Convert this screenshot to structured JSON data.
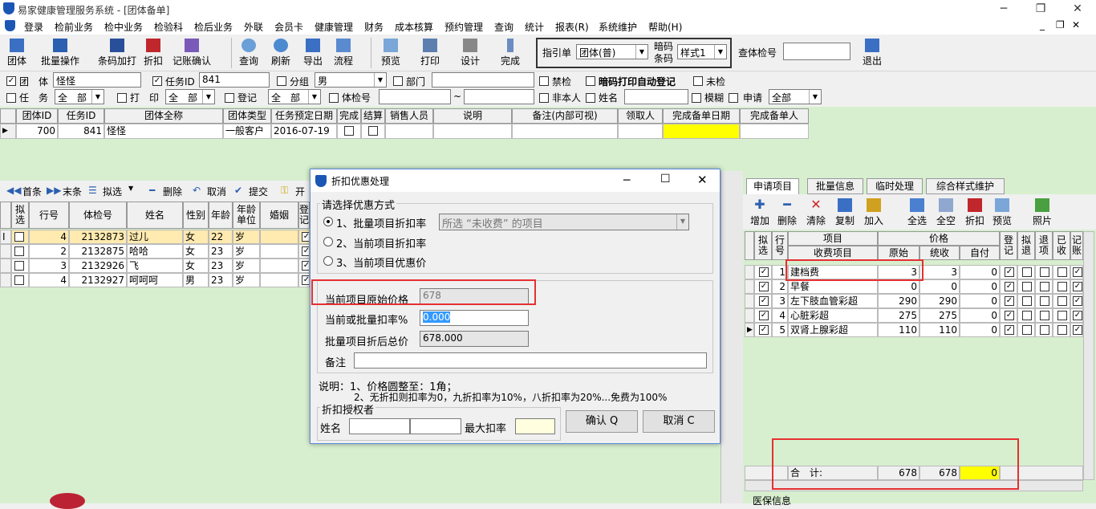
{
  "window": {
    "title": "易家健康管理服务系统 - [团体备单]",
    "min": "─",
    "restore": "❐",
    "close": "✕"
  },
  "menu": [
    "登录",
    "检前业务",
    "检中业务",
    "检验科",
    "检后业务",
    "外联",
    "会员卡",
    "健康管理",
    "财务",
    "成本核算",
    "预约管理",
    "查询",
    "统计",
    "报表(R)",
    "系统维护",
    "帮助(H)"
  ],
  "mdi_controls": {
    "min": "_",
    "restore": "❐",
    "close": "✕"
  },
  "toolbar": {
    "group": "团体",
    "batch": "批量操作",
    "barcode_add": "条码加打",
    "discount": "折扣",
    "bill_confirm": "记账确认",
    "query": "查询",
    "refresh": "刷新",
    "export": "导出",
    "flow": "流程",
    "preview": "预览",
    "print": "打印",
    "design": "设计",
    "complete": "完成",
    "guide_label": "指引单",
    "guide_value": "团体(普)",
    "barcode_label1": "暗码",
    "barcode_label2": "条码",
    "style_value": "样式1",
    "checkno_label": "查体检号",
    "checkno_value": "",
    "exit": "退出"
  },
  "filter": {
    "group_label": "团　体",
    "group_value": "怪怪",
    "task_label": "任务ID",
    "task_value": "841",
    "subgroup_label": "分组",
    "subgroup_value": "男",
    "dept_label": "部门",
    "dept_value": "",
    "ban_label": "禁检",
    "auto_reg_label": "暗码打印自动登记",
    "unchecked_label": "未检",
    "task_label2": "任　务",
    "task_sel": "全　部",
    "print_label": "打　印",
    "print_sel": "全　部",
    "reg_label": "登记",
    "reg_sel": "全　部",
    "checkno_label": "体检号",
    "tilde": "~",
    "nonself_label": "非本人",
    "name_label": "姓名",
    "fuzzy_label": "模糊",
    "apply_label": "申请",
    "apply_sel": "全部"
  },
  "top_grid": {
    "headers": [
      "团体ID",
      "任务ID",
      "团体全称",
      "团体类型",
      "任务预定日期",
      "完成",
      "结算",
      "销售人员",
      "说明",
      "备注(内部可视)",
      "领取人",
      "完成备单日期",
      "完成备单人"
    ],
    "row": [
      "700",
      "841",
      "怪怪",
      "一般客户",
      "2016-07-19",
      "",
      "",
      "",
      "",
      "",
      "",
      "",
      ""
    ]
  },
  "left_toolbar": {
    "first": "首条",
    "last": "末条",
    "select": "拟选",
    "delete": "删除",
    "cancel": "取消",
    "submit": "提交",
    "open": "开"
  },
  "left_grid": {
    "headers": [
      "拟选",
      "行号",
      "体检号",
      "姓名",
      "性别",
      "年龄",
      "年龄单位",
      "婚姻",
      "登记"
    ],
    "rows": [
      [
        "",
        "4",
        "2132873",
        "过儿",
        "女",
        "22",
        "岁",
        ""
      ],
      [
        "",
        "2",
        "2132875",
        "哈哈",
        "女",
        "23",
        "岁",
        ""
      ],
      [
        "",
        "3",
        "2132926",
        "飞",
        "女",
        "23",
        "岁",
        ""
      ],
      [
        "",
        "4",
        "2132927",
        "呵呵呵",
        "男",
        "23",
        "岁",
        ""
      ]
    ]
  },
  "right_tabs": [
    "申请项目",
    "批量信息",
    "临时处理",
    "综合样式维护"
  ],
  "right_toolbar": [
    "增加",
    "删除",
    "清除",
    "复制",
    "加入",
    "全选",
    "全空",
    "折扣",
    "预览",
    "照片"
  ],
  "right_grid": {
    "h_select": "拟选",
    "h_row": "行号",
    "h_item": "项目",
    "h_fee": "收费项目",
    "h_price": "价格",
    "h_orig": "原始",
    "h_paid": "统收",
    "h_self": "自付",
    "h_reg": "登记",
    "h_draft": "拟退",
    "h_ret": "退项",
    "h_recv": "已收",
    "h_acct": "记账",
    "rows": [
      [
        "1",
        "建档费",
        "3",
        "3",
        "0"
      ],
      [
        "2",
        "早餐",
        "0",
        "0",
        "0"
      ],
      [
        "3",
        "左下肢血管彩超",
        "290",
        "290",
        "0"
      ],
      [
        "4",
        "心脏彩超",
        "275",
        "275",
        "0"
      ],
      [
        "5",
        "双肾上腺彩超",
        "110",
        "110",
        "0"
      ]
    ],
    "total_label": "合　计:",
    "total_orig": "678",
    "total_paid": "678",
    "total_self": "0",
    "medical_label": "医保信息"
  },
  "dialog": {
    "title": "折扣优惠处理",
    "group_label": "请选择优惠方式",
    "opt1": "1、批量项目折扣率",
    "opt1_sel": "所选 “未收费” 的项目",
    "opt2": "2、当前项目折扣率",
    "opt3": "3、当前项目优惠价",
    "orig_label": "当前项目原始价格",
    "orig_value": "678",
    "rate_label": "当前或批量扣率%",
    "rate_value": "0.000",
    "total_label": "批量项目折后总价",
    "total_value": "678.000",
    "note_label": "备注",
    "note_value": "",
    "desc1": "说明：1、价格圆整至：1角；",
    "desc2": "2、无折扣则扣率为0，九折扣率为10%，八折扣率为20%...免费为100%",
    "auth_group": "折扣授权者",
    "name_label": "姓名",
    "max_label": "最大扣率",
    "ok": "确认 Q",
    "cancel": "取消 C"
  }
}
